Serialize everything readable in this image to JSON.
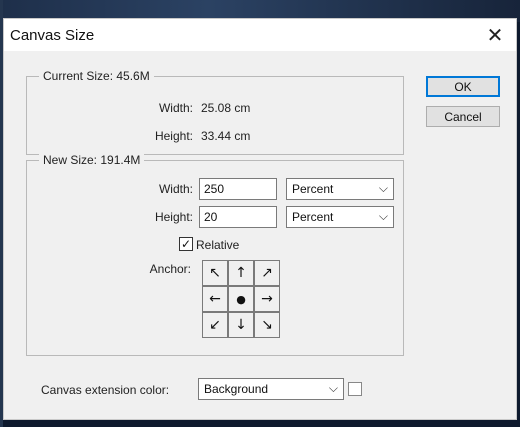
{
  "dialog": {
    "title": "Canvas Size",
    "close_glyph": "✕"
  },
  "current_size": {
    "legend": "Current Size: 45.6M",
    "width_label": "Width:",
    "width_value": "25.08 cm",
    "height_label": "Height:",
    "height_value": "33.44 cm"
  },
  "new_size": {
    "legend": "New Size: 191.4M",
    "width_label": "Width:",
    "width_value": "250",
    "width_unit": "Percent",
    "height_label": "Height:",
    "height_value": "20",
    "height_unit": "Percent",
    "relative_label": "Relative",
    "relative_checked": true,
    "anchor_label": "Anchor:",
    "anchor_cells": [
      "↖",
      "↑",
      "↗",
      "←",
      "●",
      "→",
      "↙",
      "↓",
      "↘"
    ]
  },
  "buttons": {
    "ok": "OK",
    "cancel": "Cancel"
  },
  "extension": {
    "label": "Canvas extension color:",
    "value": "Background",
    "swatch_color": "#ffffff"
  },
  "icons": {
    "close": "close-icon",
    "dropdown": "chevron-down-icon",
    "check": "checkmark-icon",
    "anchor": "arrow-icon"
  }
}
